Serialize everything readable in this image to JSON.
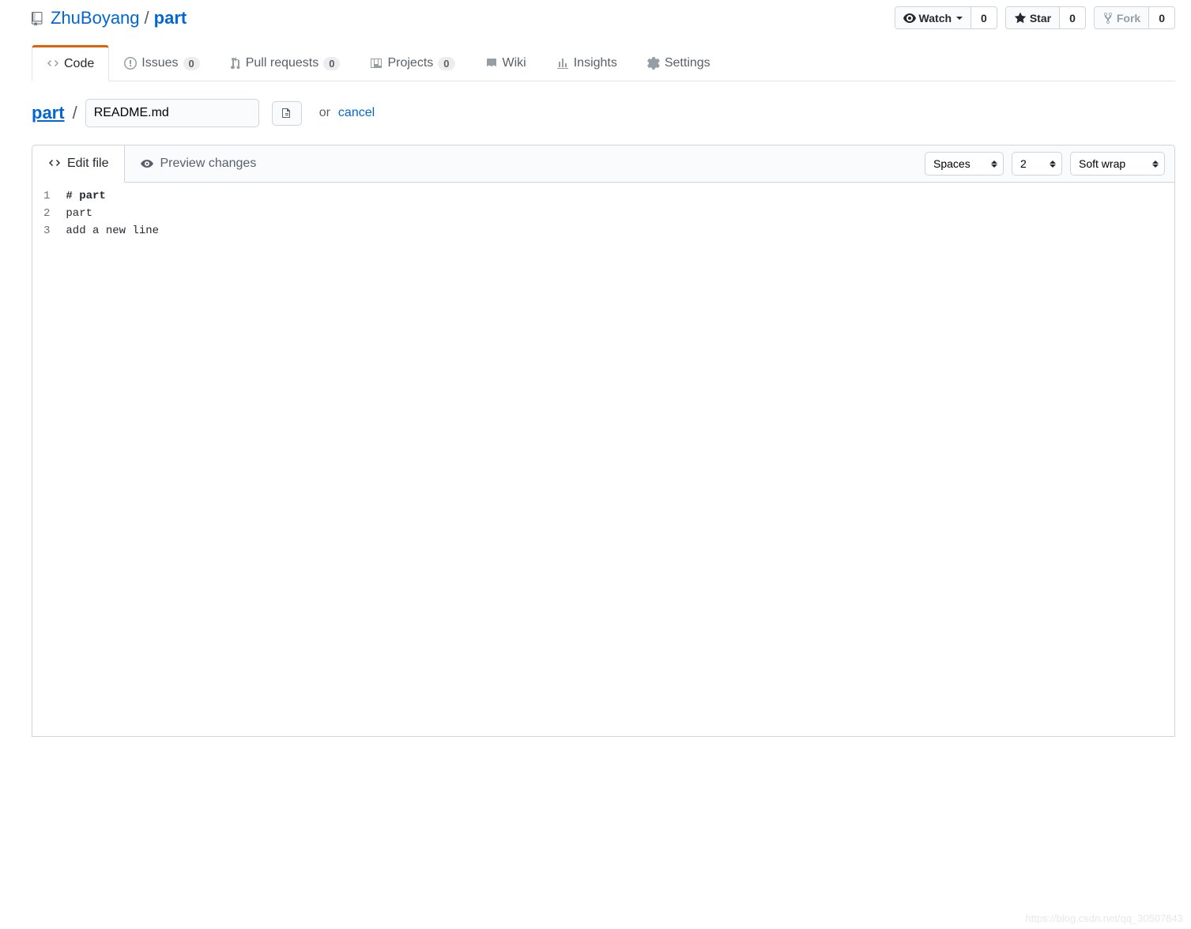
{
  "breadcrumb": {
    "owner": "ZhuBoyang",
    "repo": "part"
  },
  "actions": {
    "watch": {
      "label": "Watch",
      "count": "0"
    },
    "star": {
      "label": "Star",
      "count": "0"
    },
    "fork": {
      "label": "Fork",
      "count": "0"
    }
  },
  "tabs": {
    "code": "Code",
    "issues": {
      "label": "Issues",
      "count": "0"
    },
    "pulls": {
      "label": "Pull requests",
      "count": "0"
    },
    "projects": {
      "label": "Projects",
      "count": "0"
    },
    "wiki": "Wiki",
    "insights": "Insights",
    "settings": "Settings"
  },
  "filepath": {
    "root": "part",
    "filename": "README.md",
    "or": "or",
    "cancel": "cancel"
  },
  "editor": {
    "edit_tab": "Edit file",
    "preview_tab": "Preview changes",
    "indent_mode": "Spaces",
    "indent_size": "2",
    "wrap_mode": "Soft wrap",
    "lines": [
      {
        "n": "1",
        "text": "# part",
        "bold": true
      },
      {
        "n": "2",
        "text": "part",
        "bold": false
      },
      {
        "n": "3",
        "text": "add a new line",
        "bold": false
      }
    ]
  },
  "watermark": "https://blog.csdn.net/qq_30507843"
}
